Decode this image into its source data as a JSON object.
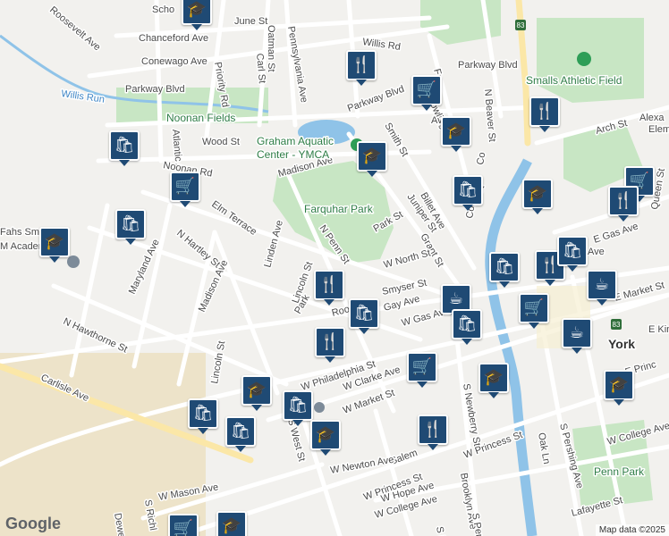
{
  "map": {
    "parks": [
      {
        "id": "farquhar",
        "name": "Farquhar Park"
      },
      {
        "id": "noonan",
        "name": "Noonan Fields"
      },
      {
        "id": "smalls",
        "name": "Smalls Athletic Field"
      },
      {
        "id": "penn",
        "name": "Penn Park"
      }
    ],
    "places": [
      {
        "id": "graham",
        "line1": "Graham Aquatic",
        "line2": "Center - YMCA"
      },
      {
        "id": "york",
        "name": "York"
      },
      {
        "id": "fahs1",
        "name": "Fahs Sm"
      },
      {
        "id": "fahs2",
        "name": "M Academy"
      },
      {
        "id": "alexa",
        "name": "Alexa"
      },
      {
        "id": "elem",
        "name": "Elem"
      },
      {
        "id": "scho",
        "name": "Scho"
      }
    ],
    "water": [
      {
        "id": "willis-run",
        "name": "Willis Run"
      }
    ],
    "highway": "83",
    "streets": [
      "Roosevelt Ave",
      "June St",
      "Chanceford Ave",
      "Oatman St",
      "Pennsylvania Ave",
      "Willis Rd",
      "Conewago Ave",
      "Priority Rd",
      "Carl St",
      "Parkway Blvd",
      "Parkway Blvd",
      "Parkway Blvd",
      "N Beaver St",
      "Wood St",
      "Atlantic Ave",
      "Noonan Rd",
      "Madison Ave",
      "Smith St",
      "Arch St",
      "Elm Terrace",
      "Linden Ave",
      "N Penn St",
      "Park St",
      "Billet Ave",
      "Juniper St",
      "Grant St",
      "N Hartley St",
      "Madison Ave",
      "Maryland Ave",
      "Lincoln St",
      "W North St",
      "Smyser St",
      "Park",
      "Gay Ave",
      "Roo",
      "N Hawthorne St",
      "E Gas Ave",
      "E Market St",
      "Lincoln St",
      "W Philadelphia St",
      "W Clarke Ave",
      "W Market St",
      "Carlisle Ave",
      "S Newberry St",
      "E Princ",
      "W Princess St",
      "W College Ave",
      "S Pershing Ave",
      "Oak Ln",
      "S West St",
      "Salem",
      "W Newton Ave",
      "W Princess St",
      "Brooklyn Ave",
      "W Hope Ave",
      "W College Ave",
      "W Mason Ave",
      "S Richl",
      "Lafayette St",
      "S Penn",
      "S Pe",
      "Dewe",
      "E King",
      "Queen St",
      "W Gas Ave",
      "Co",
      "Cott",
      "Fr",
      "Bowling Al",
      "Ave",
      "Cot",
      "Ave"
    ]
  },
  "pins": [
    {
      "id": "p1",
      "type": "school",
      "icon": "🎓"
    },
    {
      "id": "p2",
      "type": "restaurant",
      "icon": "🍴"
    },
    {
      "id": "p3",
      "type": "grocery",
      "icon": "🛒"
    },
    {
      "id": "p4",
      "type": "restaurant",
      "icon": "🍴"
    },
    {
      "id": "p5",
      "type": "shopping",
      "icon": "🛍"
    },
    {
      "id": "p6",
      "type": "school",
      "icon": "🎓"
    },
    {
      "id": "p7",
      "type": "school",
      "icon": "🎓"
    },
    {
      "id": "p8",
      "type": "grocery",
      "icon": "🛒"
    },
    {
      "id": "p9",
      "type": "shopping",
      "icon": "🛍"
    },
    {
      "id": "p10",
      "type": "school",
      "icon": "🎓"
    },
    {
      "id": "p11",
      "type": "grocery",
      "icon": "🛒"
    },
    {
      "id": "p12",
      "type": "shopping",
      "icon": "🛍"
    },
    {
      "id": "p13",
      "type": "school",
      "icon": "🎓"
    },
    {
      "id": "p14",
      "type": "restaurant",
      "icon": "🍴"
    },
    {
      "id": "p15",
      "type": "shopping",
      "icon": "🛍"
    },
    {
      "id": "p16",
      "type": "restaurant",
      "icon": "🍴"
    },
    {
      "id": "p17",
      "type": "coffee",
      "icon": "☕"
    },
    {
      "id": "p18",
      "type": "shopping",
      "icon": "🛍"
    },
    {
      "id": "p19",
      "type": "grocery",
      "icon": "🛒"
    },
    {
      "id": "p20",
      "type": "coffee",
      "icon": "☕"
    },
    {
      "id": "p21",
      "type": "coffee",
      "icon": "☕"
    },
    {
      "id": "p22",
      "type": "restaurant",
      "icon": "🍴"
    },
    {
      "id": "p23",
      "type": "shopping",
      "icon": "🛍"
    },
    {
      "id": "p24",
      "type": "grocery",
      "icon": "🛒"
    },
    {
      "id": "p25",
      "type": "school",
      "icon": "🎓"
    },
    {
      "id": "p26",
      "type": "school",
      "icon": "🎓"
    },
    {
      "id": "p27",
      "type": "shopping",
      "icon": "🛍"
    },
    {
      "id": "p28",
      "type": "shopping",
      "icon": "🛍"
    },
    {
      "id": "p29",
      "type": "shopping",
      "icon": "🛍"
    },
    {
      "id": "p30",
      "type": "shopping",
      "icon": "🛍"
    },
    {
      "id": "p31",
      "type": "school",
      "icon": "🎓"
    },
    {
      "id": "p32",
      "type": "restaurant",
      "icon": "🍴"
    },
    {
      "id": "p33",
      "type": "grocery",
      "icon": "🛒"
    },
    {
      "id": "p34",
      "type": "school",
      "icon": "🎓"
    },
    {
      "id": "p35",
      "type": "school",
      "icon": "🎓"
    },
    {
      "id": "p36",
      "type": "restaurant",
      "icon": "🍴"
    }
  ],
  "footer": {
    "logo": "Google",
    "credit": "Map data ©2025"
  }
}
